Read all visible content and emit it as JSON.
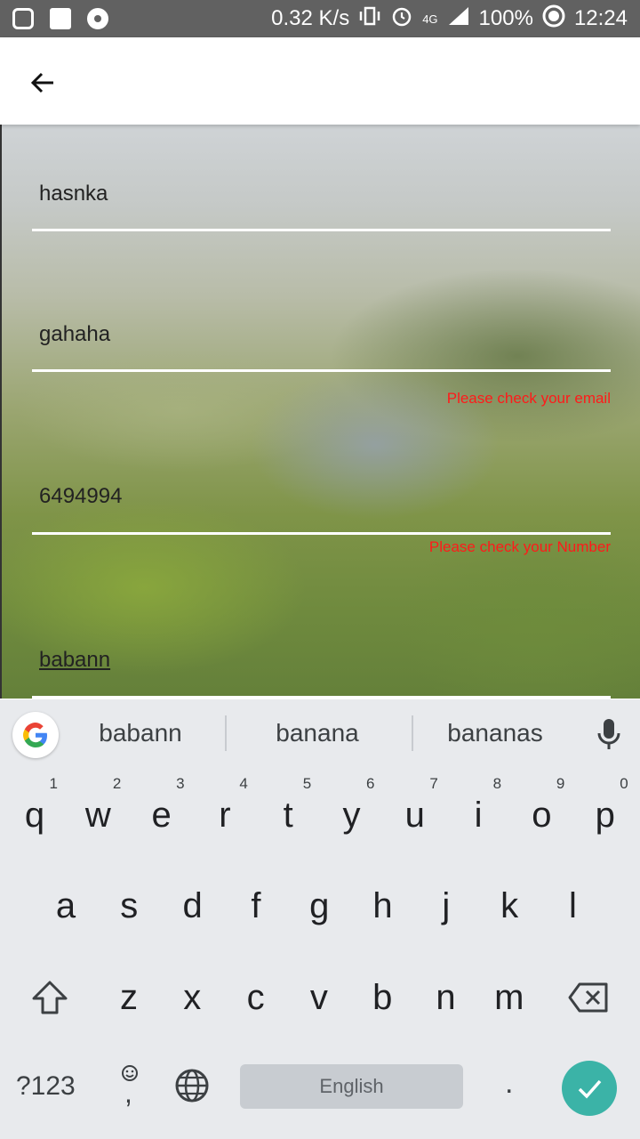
{
  "status_bar": {
    "speed": "0.32 K/s",
    "network": "4G",
    "battery": "100%",
    "time": "12:24",
    "icons": [
      "instagram-icon",
      "gallery-icon",
      "record-icon",
      "vibrate-icon",
      "alarm-icon",
      "signal-icon",
      "battery-icon"
    ]
  },
  "app_bar": {
    "back_icon": "arrow-back-icon"
  },
  "form": {
    "name_value": "hasnka",
    "email_value": "gahaha",
    "email_error": "Please check your email",
    "number_value": "6494994",
    "number_error": "Please check your Number",
    "fourth_value": "babann",
    "line_color": "#ffffff",
    "error_color": "#ff1a1a"
  },
  "keyboard": {
    "suggestions": [
      "babann",
      "banana",
      "bananas"
    ],
    "row1": [
      "q",
      "w",
      "e",
      "r",
      "t",
      "y",
      "u",
      "i",
      "o",
      "p"
    ],
    "row1_hints": [
      "1",
      "2",
      "3",
      "4",
      "5",
      "6",
      "7",
      "8",
      "9",
      "0"
    ],
    "row2": [
      "a",
      "s",
      "d",
      "f",
      "g",
      "h",
      "j",
      "k",
      "l"
    ],
    "row3": [
      "z",
      "x",
      "c",
      "v",
      "b",
      "n",
      "m"
    ],
    "symbols_label": "?123",
    "emoji_comma": ",",
    "space_label": "English",
    "period": ".",
    "accent_color": "#3bb3a7"
  }
}
